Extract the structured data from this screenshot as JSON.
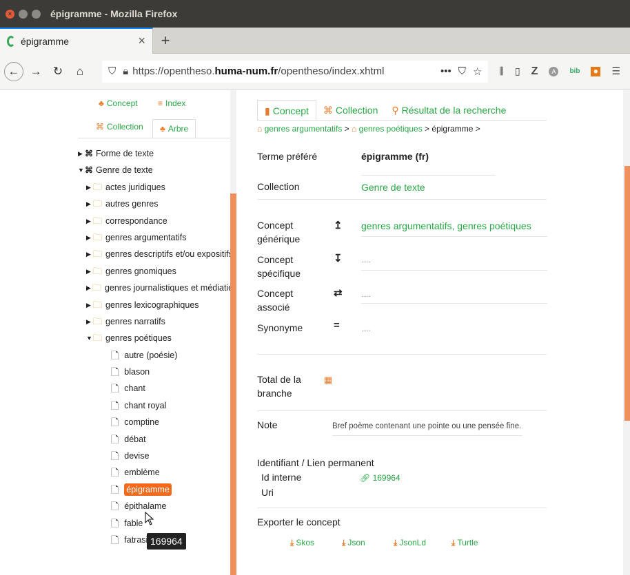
{
  "window": {
    "title": "épigramme - Mozilla Firefox"
  },
  "tab": {
    "title": "épigramme",
    "close": "×",
    "new": "+"
  },
  "nav": {
    "url_prefix": "https://opentheso.",
    "url_host": "huma-num.fr",
    "url_suffix": "/opentheso/index.xhtml",
    "more": "•••"
  },
  "sidebar": {
    "tabs": [
      {
        "label": "Concept"
      },
      {
        "label": "Index"
      },
      {
        "label": "Collection"
      },
      {
        "label": "Arbre"
      }
    ],
    "tree": [
      {
        "label": "Forme de texte",
        "level": 1,
        "kind": "collection",
        "expanded": false
      },
      {
        "label": "Genre de texte",
        "level": 1,
        "kind": "collection",
        "expanded": true
      },
      {
        "label": "actes juridiques",
        "level": 2,
        "kind": "folder",
        "expanded": false
      },
      {
        "label": "autres genres",
        "level": 2,
        "kind": "folder",
        "expanded": false
      },
      {
        "label": "correspondance",
        "level": 2,
        "kind": "folder",
        "expanded": false
      },
      {
        "label": "genres argumentatifs",
        "level": 2,
        "kind": "folder",
        "expanded": false
      },
      {
        "label": "genres descriptifs et/ou expositifs",
        "level": 2,
        "kind": "folder",
        "expanded": false
      },
      {
        "label": "genres gnomiques",
        "level": 2,
        "kind": "folder",
        "expanded": false
      },
      {
        "label": "genres journalistiques et médiatiques",
        "level": 2,
        "kind": "folder",
        "expanded": false
      },
      {
        "label": "genres lexicographiques",
        "level": 2,
        "kind": "folder",
        "expanded": false
      },
      {
        "label": "genres narratifs",
        "level": 2,
        "kind": "folder",
        "expanded": false
      },
      {
        "label": "genres poétiques",
        "level": 2,
        "kind": "folder",
        "expanded": true
      },
      {
        "label": "autre (poésie)",
        "level": 3,
        "kind": "leaf"
      },
      {
        "label": "blason",
        "level": 3,
        "kind": "leaf"
      },
      {
        "label": "chant",
        "level": 3,
        "kind": "leaf"
      },
      {
        "label": "chant royal",
        "level": 3,
        "kind": "leaf"
      },
      {
        "label": "comptine",
        "level": 3,
        "kind": "leaf"
      },
      {
        "label": "débat",
        "level": 3,
        "kind": "leaf"
      },
      {
        "label": "devise",
        "level": 3,
        "kind": "leaf"
      },
      {
        "label": "emblème",
        "level": 3,
        "kind": "leaf"
      },
      {
        "label": "épigramme",
        "level": 3,
        "kind": "leaf",
        "selected": true
      },
      {
        "label": "épithalame",
        "level": 3,
        "kind": "leaf"
      },
      {
        "label": "fable",
        "level": 3,
        "kind": "leaf"
      },
      {
        "label": "fatrasie",
        "level": 3,
        "kind": "leaf"
      }
    ],
    "tooltip": "169964"
  },
  "main": {
    "tabs": [
      {
        "label": "Concept"
      },
      {
        "label": "Collection"
      },
      {
        "label": "Résultat de la recherche"
      }
    ],
    "breadcrumb": {
      "items": [
        "genres argumentatifs",
        "genres poétiques"
      ],
      "current": "épigramme",
      "sep": ">"
    },
    "preferred_label": "Terme préféré",
    "preferred_value": "épigramme (fr)",
    "collection_label": "Collection",
    "collection_value": "Genre de texte",
    "broader_label_1": "Concept",
    "broader_label_2": "générique",
    "broader_value": "genres argumentatifs, genres poétiques",
    "narrower_label_1": "Concept",
    "narrower_label_2": "spécifique",
    "narrower_value": ".....",
    "related_label_1": "Concept",
    "related_label_2": "associé",
    "related_value": ".....",
    "synonym_label": "Synonyme",
    "synonym_value": ".....",
    "total_label_1": "Total de la",
    "total_label_2": "branche",
    "note_label": "Note",
    "note_value": "Bref poème contenant une pointe ou une pensée fine.",
    "identifier_heading": "Identifiant / Lien permanent",
    "id_label": "Id interne",
    "id_value": "169964",
    "uri_label": "Uri",
    "export_heading": "Exporter le concept",
    "exports": [
      "Skos",
      "Json",
      "JsonLd",
      "Turtle"
    ]
  },
  "colors": {
    "accent_green": "#28a745",
    "accent_orange": "#f26a1b",
    "scrollbar": "#ee8f5d"
  }
}
